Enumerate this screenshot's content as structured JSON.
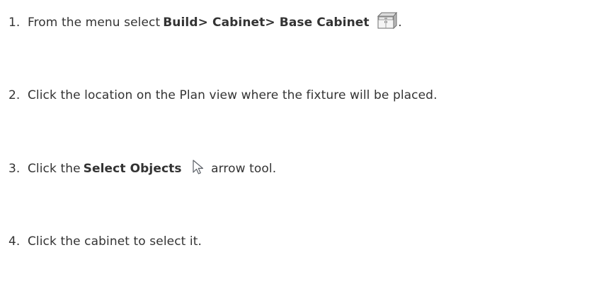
{
  "steps": [
    {
      "number": "1.",
      "text_before": "From the menu select",
      "bold": "Build> Cabinet> Base Cabinet",
      "icon": "base-cabinet-icon",
      "text_after": "."
    },
    {
      "number": "2.",
      "text": "Click the location on the Plan view where the fixture will be placed."
    },
    {
      "number": "3.",
      "text_before": "Click the",
      "bold": "Select Objects",
      "icon": "select-arrow-icon",
      "text_after": "arrow tool."
    },
    {
      "number": "4.",
      "text": "Click the cabinet to select it."
    }
  ]
}
